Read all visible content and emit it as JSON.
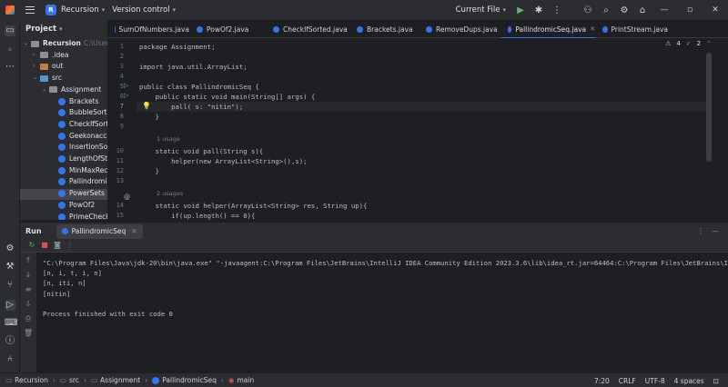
{
  "titlebar": {
    "project_badge": "R",
    "project_name": "Recursion",
    "vcs": "Version control",
    "run_config": "Current File"
  },
  "project_panel": {
    "title": "Project",
    "items": [
      {
        "label": "Recursion",
        "path": "C:\\Users\\",
        "indent": 0
      },
      {
        "label": ".idea",
        "indent": 1
      },
      {
        "label": "out",
        "indent": 1
      },
      {
        "label": "src",
        "indent": 1
      },
      {
        "label": "Assignment",
        "indent": 2
      },
      {
        "label": "Brackets",
        "indent": 3
      },
      {
        "label": "BubbleSortR",
        "indent": 3
      },
      {
        "label": "CheckIfSort",
        "indent": 3
      },
      {
        "label": "Geekonacci",
        "indent": 3
      },
      {
        "label": "InsertionSor",
        "indent": 3
      },
      {
        "label": "LengthOfStr",
        "indent": 3
      },
      {
        "label": "MinMaxRecu",
        "indent": 3
      },
      {
        "label": "Pallindromi",
        "indent": 3
      },
      {
        "label": "PowerSets",
        "indent": 3
      },
      {
        "label": "PowOf2",
        "indent": 3
      },
      {
        "label": "PrimeCheck",
        "indent": 3
      }
    ]
  },
  "tabs": [
    {
      "label": "SumOfNumbers.java"
    },
    {
      "label": "PowOf2.java"
    },
    {
      "label": "CheckIfSorted.java"
    },
    {
      "label": "Brackets.java"
    },
    {
      "label": "RemoveDups.java"
    },
    {
      "label": "PallindromicSeq.java",
      "active": true
    },
    {
      "label": "PrintStream.java"
    }
  ],
  "editor": {
    "warnings": "4",
    "checks": "2",
    "lines": [
      {
        "n": "1",
        "code": "package Assignment;"
      },
      {
        "n": "2",
        "code": ""
      },
      {
        "n": "3",
        "code": "import java.util.ArrayList;"
      },
      {
        "n": "4",
        "code": ""
      },
      {
        "n": "5",
        "code": "public class PallindromicSeq {"
      },
      {
        "n": "6",
        "code": "    public static void main(String[] args) {"
      },
      {
        "n": "7",
        "code": "        pall( s: \"nitin\");"
      },
      {
        "n": "8",
        "code": "    }"
      },
      {
        "n": "9",
        "code": ""
      },
      {
        "n": "10",
        "code": "    static void pall(String s){"
      },
      {
        "n": "11",
        "code": "        helper(new ArrayList<String>(),s);"
      },
      {
        "n": "12",
        "code": "    }"
      },
      {
        "n": "13",
        "code": ""
      },
      {
        "n": "14",
        "code": "    static void helper(ArrayList<String> res, String up){"
      },
      {
        "n": "15",
        "code": "        if(up.length() == 0){"
      }
    ],
    "usage1": "1 usage",
    "usage2": "2 usages"
  },
  "run": {
    "title": "Run",
    "tab": "PallindromicSeq",
    "output": [
      "\"C:\\Program Files\\Java\\jdk-20\\bin\\java.exe\" \"-javaagent:C:\\Program Files\\JetBrains\\IntelliJ IDEA Community Edition 2023.3.6\\lib\\idea_rt.jar=64464:C:\\Program Files\\JetBrains\\Int",
      "[n, i, t, i, n]",
      "[n, iti, n]",
      "[nitin]",
      "",
      "Process finished with exit code 0"
    ]
  },
  "status": {
    "crumbs": [
      "Recursion",
      "src",
      "Assignment",
      "PallindromicSeq",
      "main"
    ],
    "position": "7:20",
    "line_sep": "CRLF",
    "encoding": "UTF-8",
    "indent": "4 spaces"
  }
}
